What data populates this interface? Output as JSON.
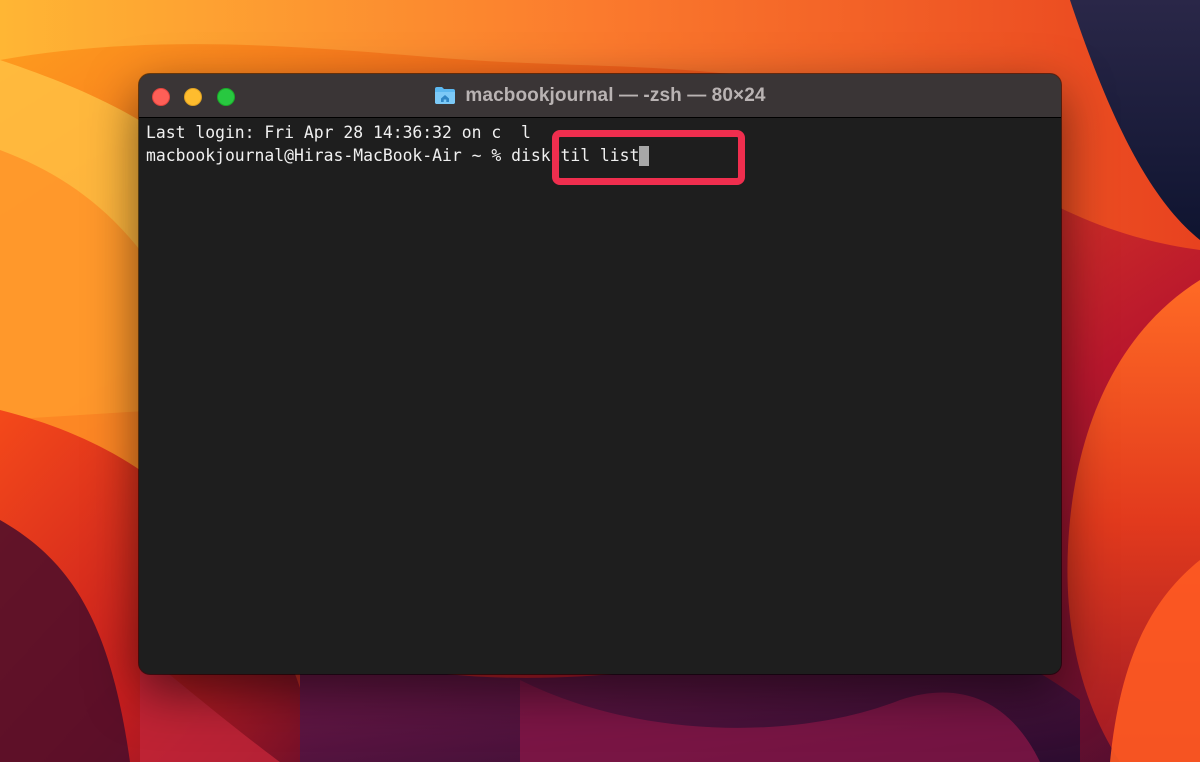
{
  "window": {
    "title": "macbookjournal — -zsh — 80×24",
    "title_icon": "home-folder-icon"
  },
  "terminal": {
    "last_login": "Last login: Fri Apr 28 14:36:32 on c",
    "last_login_tail": "l",
    "prompt": "macbookjournal@Hiras-MacBook-Air ~ % ",
    "command": "diskutil list"
  },
  "colors": {
    "highlight": "#ef2e4e",
    "terminal_bg": "#1e1e1e",
    "title_bar": "#3a3536",
    "close": "#fe5f57",
    "minimize": "#febc2e",
    "maximize": "#28c840"
  }
}
